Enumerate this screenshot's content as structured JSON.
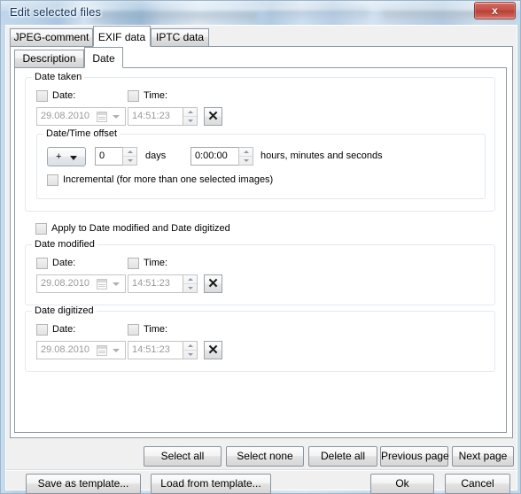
{
  "window": {
    "title": "Edit selected files",
    "close_label": "x",
    "close_icon": "close-icon"
  },
  "outer_tabs": [
    {
      "label": "JPEG-comment",
      "active": false
    },
    {
      "label": "EXIF data",
      "active": true
    },
    {
      "label": "IPTC data",
      "active": false
    }
  ],
  "inner_tabs": [
    {
      "label": "Description",
      "active": false
    },
    {
      "label": "Date",
      "active": true
    }
  ],
  "groups": {
    "date_taken": {
      "title": "Date taken",
      "date_checkbox_label": "Date:",
      "time_checkbox_label": "Time:",
      "date_value": "29.08.2010",
      "time_value": "14:51:23",
      "clear_label": "✕",
      "date_checked": false,
      "time_checked": false
    },
    "offset": {
      "title": "Date/Time offset",
      "sign_value": "+",
      "sign_options": [
        "+",
        "-"
      ],
      "days_value": "0",
      "days_label": "days",
      "hms_value": "0:00:00",
      "hms_label": "hours, minutes and seconds",
      "incremental_label": "Incremental (for more than one selected images)",
      "incremental_checked": false
    },
    "apply_all": {
      "label": "Apply to Date modified and Date digitized",
      "checked": false
    },
    "date_modified": {
      "title": "Date modified",
      "date_checkbox_label": "Date:",
      "time_checkbox_label": "Time:",
      "date_value": "29.08.2010",
      "time_value": "14:51:23",
      "clear_label": "✕",
      "date_checked": false,
      "time_checked": false
    },
    "date_digitized": {
      "title": "Date digitized",
      "date_checkbox_label": "Date:",
      "time_checkbox_label": "Time:",
      "date_value": "29.08.2010",
      "time_value": "14:51:23",
      "clear_label": "✕",
      "date_checked": false,
      "time_checked": false
    }
  },
  "toolbar_buttons": {
    "select_all": "Select all",
    "select_none": "Select none",
    "delete_all": "Delete all",
    "previous_page": "Previous page",
    "next_page": "Next page"
  },
  "footer_buttons": {
    "save_template": "Save as template...",
    "load_template": "Load from template...",
    "ok": "Ok",
    "cancel": "Cancel"
  },
  "colors": {
    "title_text": "#15355c",
    "close_button": "#c14f45",
    "dialog_bg": "#f0f0f0",
    "panel_bg": "#ffffff",
    "disabled_text": "#9a9a9a",
    "group_border": "#e3e8ef"
  }
}
